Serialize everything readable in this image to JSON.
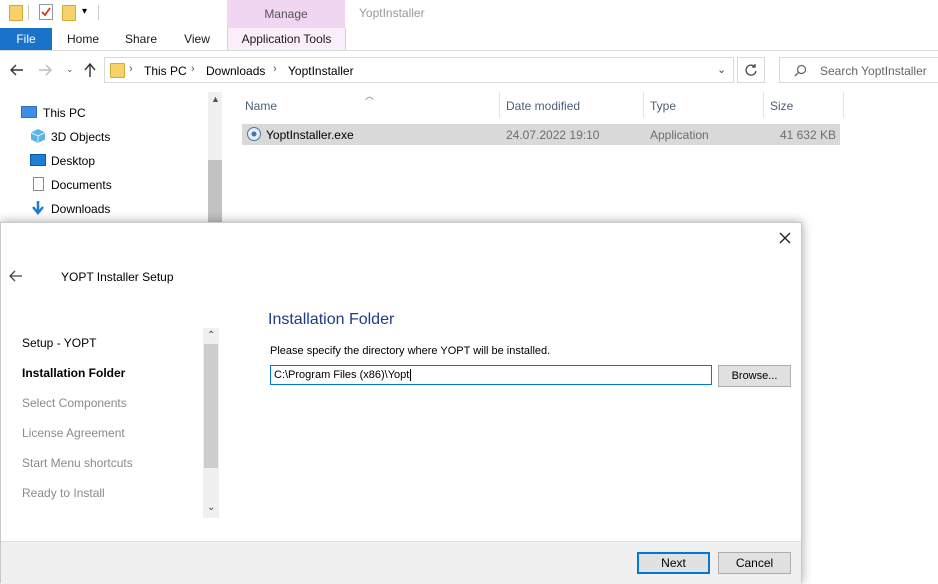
{
  "window": {
    "title": "YoptInstaller",
    "context_tab_group": "Manage"
  },
  "ribbon": {
    "tabs": [
      "File",
      "Home",
      "Share",
      "View",
      "Application Tools"
    ]
  },
  "address": {
    "crumbs": [
      "This PC",
      "Downloads",
      "YoptInstaller"
    ],
    "search_placeholder": "Search YoptInstaller"
  },
  "nav": {
    "items": [
      "This PC",
      "3D Objects",
      "Desktop",
      "Documents",
      "Downloads"
    ]
  },
  "columns": [
    "Name",
    "Date modified",
    "Type",
    "Size"
  ],
  "files": [
    {
      "name": "YoptInstaller.exe",
      "date": "24.07.2022 19:10",
      "type": "Application",
      "size": "41 632 KB"
    }
  ],
  "dialog": {
    "title": "YOPT Installer Setup",
    "steps": [
      "Setup - YOPT",
      "Installation Folder",
      "Select Components",
      "License Agreement",
      "Start Menu shortcuts",
      "Ready to Install"
    ],
    "active_step": "Installation Folder",
    "heading": "Installation Folder",
    "instruction": "Please specify the directory where YOPT will be installed.",
    "path_value": "C:\\Program Files (x86)\\Yopt",
    "browse_label": "Browse...",
    "next_label": "Next",
    "cancel_label": "Cancel"
  },
  "icons": [
    "folder-icon",
    "checkmark-icon",
    "dropdown-icon",
    "back-arrow-icon",
    "forward-arrow-icon",
    "up-arrow-icon",
    "refresh-icon",
    "search-icon",
    "close-icon",
    "sort-up-icon"
  ],
  "colors": {
    "file_tab": "#1a73c8",
    "manage": "#f0d6f0",
    "heading": "#1f3a8a",
    "selection": "#d9d9d9"
  }
}
